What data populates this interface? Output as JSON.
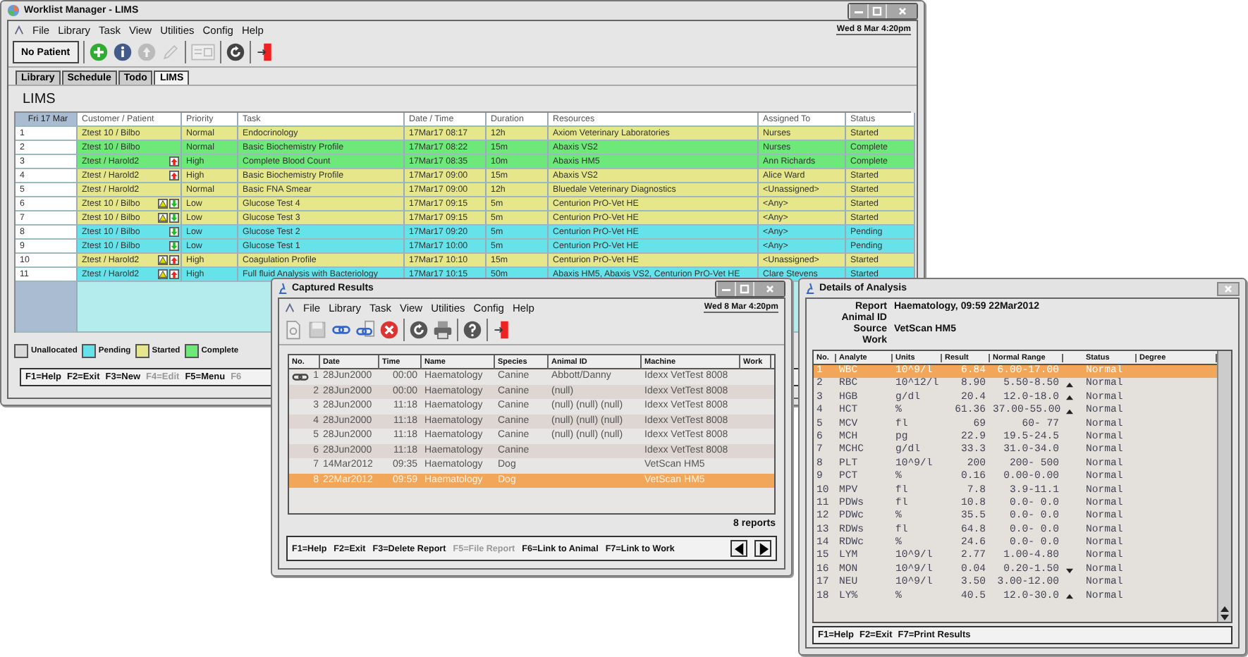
{
  "main": {
    "title": "Worklist Manager - LIMS",
    "menu": [
      "File",
      "Library",
      "Task",
      "View",
      "Utilities",
      "Config",
      "Help"
    ],
    "clock": "Wed 8 Mar 4:20pm",
    "patient_button": "No Patient",
    "tabs": [
      {
        "label": "Library",
        "selected": false
      },
      {
        "label": "Schedule",
        "selected": false
      },
      {
        "label": "Todo",
        "selected": false
      },
      {
        "label": "LIMS",
        "selected": true
      }
    ],
    "heading": "LIMS",
    "table": {
      "date_header": "Fri 17 Mar",
      "columns": [
        "Customer / Patient",
        "Priority",
        "Task",
        "Date / Time",
        "Duration",
        "Resources",
        "Assigned To",
        "Status"
      ],
      "rows": [
        {
          "number": "1",
          "customer": "Ztest 10 / Bilbo",
          "warning": false,
          "up_arrow": false,
          "down_arrow": false,
          "priority": "Normal",
          "task": "Endocrinology",
          "datetime": "17Mar17 08:17",
          "duration": "12h",
          "resources": "Axiom Veterinary Laboratories",
          "assigned": "Nurses",
          "status": "Started",
          "color": "#e6e68a"
        },
        {
          "number": "2",
          "customer": "Ztest 10 / Bilbo",
          "warning": false,
          "up_arrow": false,
          "down_arrow": false,
          "priority": "Normal",
          "task": "Basic Biochemistry Profile",
          "datetime": "17Mar17 08:22",
          "duration": "15m",
          "resources": "Abaxis VS2",
          "assigned": "Nurses",
          "status": "Complete",
          "color": "#6ee878"
        },
        {
          "number": "3",
          "customer": "Ztest / Harold2",
          "warning": false,
          "up_arrow": true,
          "down_arrow": false,
          "priority": "High",
          "task": "Complete Blood Count",
          "datetime": "17Mar17 08:35",
          "duration": "10m",
          "resources": "Abaxis HM5",
          "assigned": "Ann Richards",
          "status": "Complete",
          "color": "#6ee878"
        },
        {
          "number": "4",
          "customer": "Ztest / Harold2",
          "warning": false,
          "up_arrow": true,
          "down_arrow": false,
          "priority": "High",
          "task": "Basic Biochemistry Profile",
          "datetime": "17Mar17 09:00",
          "duration": "15m",
          "resources": "Abaxis VS2",
          "assigned": "Alice Ward",
          "status": "Started",
          "color": "#e6e68a"
        },
        {
          "number": "5",
          "customer": "Ztest / Harold2",
          "warning": false,
          "up_arrow": false,
          "down_arrow": false,
          "priority": "Normal",
          "task": "Basic FNA Smear",
          "datetime": "17Mar17 09:00",
          "duration": "12h",
          "resources": "Bluedale Veterinary Diagnostics",
          "assigned": "<Unassigned>",
          "status": "Started",
          "color": "#e6e68a"
        },
        {
          "number": "6",
          "customer": "Ztest 10 / Bilbo",
          "warning": true,
          "up_arrow": false,
          "down_arrow": true,
          "priority": "Low",
          "task": "Glucose Test 4",
          "datetime": "17Mar17 09:15",
          "duration": "5m",
          "resources": "Centurion PrO-Vet HE",
          "assigned": "<Any>",
          "status": "Started",
          "color": "#e6e68a"
        },
        {
          "number": "7",
          "customer": "Ztest 10 / Bilbo",
          "warning": true,
          "up_arrow": false,
          "down_arrow": true,
          "priority": "Low",
          "task": "Glucose Test 3",
          "datetime": "17Mar17 09:15",
          "duration": "5m",
          "resources": "Centurion PrO-Vet HE",
          "assigned": "<Any>",
          "status": "Started",
          "color": "#e6e68a"
        },
        {
          "number": "8",
          "customer": "Ztest 10 / Bilbo",
          "warning": false,
          "up_arrow": false,
          "down_arrow": true,
          "priority": "Low",
          "task": "Glucose Test 2",
          "datetime": "17Mar17 09:20",
          "duration": "5m",
          "resources": "Centurion PrO-Vet HE",
          "assigned": "<Any>",
          "status": "Pending",
          "color": "#66e3ea"
        },
        {
          "number": "9",
          "customer": "Ztest 10 / Bilbo",
          "warning": false,
          "up_arrow": false,
          "down_arrow": true,
          "priority": "Low",
          "task": "Glucose Test 1",
          "datetime": "17Mar17 10:00",
          "duration": "5m",
          "resources": "Centurion PrO-Vet HE",
          "assigned": "<Any>",
          "status": "Pending",
          "color": "#66e3ea"
        },
        {
          "number": "10",
          "customer": "Ztest / Harold2",
          "warning": true,
          "up_arrow": true,
          "down_arrow": false,
          "priority": "High",
          "task": "Coagulation Profile",
          "datetime": "17Mar17 10:10",
          "duration": "15m",
          "resources": "Centurion PrO-Vet HE",
          "assigned": "<Unassigned>",
          "status": "Started",
          "color": "#e6e68a"
        },
        {
          "number": "11",
          "customer": "Ztest / Harold2",
          "warning": true,
          "up_arrow": true,
          "down_arrow": false,
          "priority": "High",
          "task": "Full fluid Analysis with Bacteriology",
          "datetime": "17Mar17 10:15",
          "duration": "50m",
          "resources": "Abaxis HM5, Abaxis VS2, Centurion PrO-Vet HE",
          "assigned": "Clare Stevens",
          "status": "Started",
          "color": "#66e3ea"
        }
      ]
    },
    "legend": [
      {
        "label": "Unallocated",
        "color": "#d9d9d9"
      },
      {
        "label": "Pending",
        "color": "#66e3ea"
      },
      {
        "label": "Started",
        "color": "#e6e68a"
      },
      {
        "label": "Complete",
        "color": "#6ee878"
      }
    ],
    "function_keys": [
      {
        "label": "F1=Help",
        "disabled": false
      },
      {
        "label": "F2=Exit",
        "disabled": false
      },
      {
        "label": "F3=New",
        "disabled": false
      },
      {
        "label": "F4=Edit",
        "disabled": true
      },
      {
        "label": "F5=Menu",
        "disabled": false
      },
      {
        "label": "F6",
        "disabled": true
      }
    ]
  },
  "captured": {
    "title": "Captured Results",
    "menu": [
      "File",
      "Library",
      "Task",
      "View",
      "Utilities",
      "Config",
      "Help"
    ],
    "clock": "Wed 8 Mar 4:20pm",
    "columns": [
      "No.",
      "Date",
      "Time",
      "Name",
      "Species",
      "Animal ID",
      "Machine",
      "Work"
    ],
    "rows": [
      {
        "number": "1",
        "date": "28Jun2000",
        "time": "00:00",
        "name": "Haematology",
        "species": "Canine",
        "animal_id": "Abbott/Danny",
        "machine": "Idexx VetTest 8008",
        "linked": true,
        "selected": false
      },
      {
        "number": "2",
        "date": "28Jun2000",
        "time": "00:00",
        "name": "Haematology",
        "species": "Canine",
        "animal_id": "(null)",
        "machine": "Idexx VetTest 8008",
        "linked": false,
        "selected": false
      },
      {
        "number": "3",
        "date": "28Jun2000",
        "time": "11:18",
        "name": "Haematology",
        "species": "Canine",
        "animal_id": "(null) (null) (null)",
        "machine": "Idexx VetTest 8008",
        "linked": false,
        "selected": false
      },
      {
        "number": "4",
        "date": "28Jun2000",
        "time": "11:18",
        "name": "Haematology",
        "species": "Canine",
        "animal_id": "(null) (null) (null)",
        "machine": "Idexx VetTest 8008",
        "linked": false,
        "selected": false
      },
      {
        "number": "5",
        "date": "28Jun2000",
        "time": "11:18",
        "name": "Haematology",
        "species": "Canine",
        "animal_id": "(null) (null) (null)",
        "machine": "Idexx VetTest 8008",
        "linked": false,
        "selected": false
      },
      {
        "number": "6",
        "date": "28Jun2000",
        "time": "11:18",
        "name": "Haematology",
        "species": "Canine",
        "machine": "Idexx VetTest 8008",
        "linked": false,
        "selected": false
      },
      {
        "number": "7",
        "date": "14Mar2012",
        "time": "09:35",
        "name": "Haematology",
        "species": "Dog",
        "machine": "VetScan HM5",
        "linked": false,
        "selected": false
      },
      {
        "number": "8",
        "date": "22Mar2012",
        "time": "09:59",
        "name": "Haematology",
        "species": "Dog",
        "machine": "VetScan HM5",
        "linked": false,
        "selected": true
      }
    ],
    "count": "8 reports",
    "function_keys": [
      {
        "label": "F1=Help",
        "disabled": false
      },
      {
        "label": "F2=Exit",
        "disabled": false
      },
      {
        "label": "F3=Delete Report",
        "disabled": false
      },
      {
        "label": "F5=File Report",
        "disabled": true
      },
      {
        "label": "F6=Link to Animal",
        "disabled": false
      },
      {
        "label": "F7=Link to Work",
        "disabled": false
      }
    ]
  },
  "details": {
    "title": "Details of Analysis",
    "fields": [
      {
        "label": "Report",
        "value": "Haematology, 09:59 22Mar2012"
      },
      {
        "label": "Animal ID"
      },
      {
        "label": "Source",
        "value": "VetScan HM5"
      },
      {
        "label": "Work"
      }
    ],
    "columns": [
      "No.",
      "Analyte",
      "Units",
      "Result",
      "Normal Range",
      "Status",
      "Degree"
    ],
    "rows": [
      {
        "number": "1",
        "analyte": "WBC",
        "units": "10^9/l",
        "result": "6.84",
        "range": "6.00-17.00",
        "above": false,
        "below": false,
        "status": "Normal",
        "selected": true
      },
      {
        "number": "2",
        "analyte": "RBC",
        "units": "10^12/l",
        "result": "8.90",
        "range": "5.50-8.50",
        "above": true,
        "below": false,
        "status": "Normal",
        "selected": false
      },
      {
        "number": "3",
        "analyte": "HGB",
        "units": "g/dl",
        "result": "20.4",
        "range": "12.0-18.0",
        "above": true,
        "below": false,
        "status": "Normal",
        "selected": false
      },
      {
        "number": "4",
        "analyte": "HCT",
        "units": "%",
        "result": "61.36",
        "range": "37.00-55.00",
        "above": true,
        "below": false,
        "status": "Normal",
        "selected": false
      },
      {
        "number": "5",
        "analyte": "MCV",
        "units": "fl",
        "result": "69",
        "range": "60- 77",
        "above": false,
        "below": false,
        "status": "Normal",
        "selected": false
      },
      {
        "number": "6",
        "analyte": "MCH",
        "units": "pg",
        "result": "22.9",
        "range": "19.5-24.5",
        "above": false,
        "below": false,
        "status": "Normal",
        "selected": false
      },
      {
        "number": "7",
        "analyte": "MCHC",
        "units": "g/dl",
        "result": "33.3",
        "range": "31.0-34.0",
        "above": false,
        "below": false,
        "status": "Normal",
        "selected": false
      },
      {
        "number": "8",
        "analyte": "PLT",
        "units": "10^9/l",
        "result": "200",
        "range": "200- 500",
        "above": false,
        "below": false,
        "status": "Normal",
        "selected": false
      },
      {
        "number": "9",
        "analyte": "PCT",
        "units": "%",
        "result": "0.16",
        "range": "0.00-0.00",
        "above": false,
        "below": false,
        "status": "Normal",
        "selected": false
      },
      {
        "number": "10",
        "analyte": "MPV",
        "units": "fl",
        "result": "7.8",
        "range": "3.9-11.1",
        "above": false,
        "below": false,
        "status": "Normal",
        "selected": false
      },
      {
        "number": "11",
        "analyte": "PDWs",
        "units": "fl",
        "result": "10.8",
        "range": "0.0- 0.0",
        "above": false,
        "below": false,
        "status": "Normal",
        "selected": false
      },
      {
        "number": "12",
        "analyte": "PDWc",
        "units": "%",
        "result": "35.5",
        "range": "0.0- 0.0",
        "above": false,
        "below": false,
        "status": "Normal",
        "selected": false
      },
      {
        "number": "13",
        "analyte": "RDWs",
        "units": "fl",
        "result": "64.8",
        "range": "0.0- 0.0",
        "above": false,
        "below": false,
        "status": "Normal",
        "selected": false
      },
      {
        "number": "14",
        "analyte": "RDWc",
        "units": "%",
        "result": "24.6",
        "range": "0.0- 0.0",
        "above": false,
        "below": false,
        "status": "Normal",
        "selected": false
      },
      {
        "number": "15",
        "analyte": "LYM",
        "units": "10^9/l",
        "result": "2.77",
        "range": "1.00-4.80",
        "above": false,
        "below": false,
        "status": "Normal",
        "selected": false
      },
      {
        "number": "16",
        "analyte": "MON",
        "units": "10^9/l",
        "result": "0.04",
        "range": "0.20-1.50",
        "above": false,
        "below": true,
        "status": "Normal",
        "selected": false
      },
      {
        "number": "17",
        "analyte": "NEU",
        "units": "10^9/l",
        "result": "3.50",
        "range": "3.00-12.00",
        "above": false,
        "below": false,
        "status": "Normal",
        "selected": false
      },
      {
        "number": "18",
        "analyte": "LY%",
        "units": "%",
        "result": "40.5",
        "range": "12.0-30.0",
        "above": true,
        "below": false,
        "status": "Normal",
        "selected": false
      }
    ],
    "function_keys": [
      {
        "label": "F1=Help",
        "disabled": false
      },
      {
        "label": "F2=Exit",
        "disabled": false
      },
      {
        "label": "F7=Print Results",
        "disabled": false
      }
    ]
  }
}
